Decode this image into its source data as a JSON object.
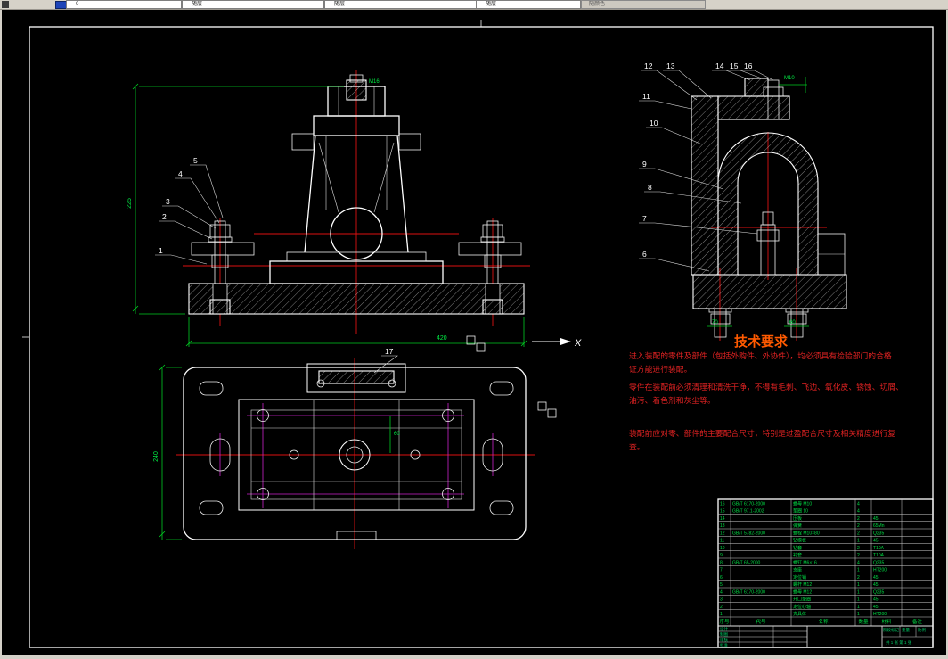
{
  "toolbar": {
    "layer_value": "0",
    "color_value": "随层",
    "linetype_value": "随层",
    "lineweight_value": "随层",
    "plotstyle_value": "随颜色"
  },
  "axis": {
    "x_label": "X"
  },
  "balloons": {
    "front": [
      "1",
      "2",
      "3",
      "4",
      "5"
    ],
    "side_top": [
      "12",
      "13",
      "14",
      "15",
      "16"
    ],
    "side_left": [
      "11",
      "10",
      "9",
      "8",
      "7",
      "6"
    ],
    "plan": [
      "17"
    ]
  },
  "dims": {
    "front_left": "225",
    "front_bottom": "420",
    "front_top_thread": "M16",
    "side_top_thread": "M10",
    "side_bolt_left": "70",
    "side_bolt_right": "60",
    "top_left": "240",
    "top_center": "60"
  },
  "tech": {
    "title": "技术要求",
    "lines": [
      "进入装配的零件及部件（包括外购件、外协件），均必须具有检验部门的合格",
      "证方能进行装配。",
      "零件在装配前必须清理和清洗干净，不得有毛刺、飞边、氧化皮、锈蚀、切屑、",
      "油污、着色剂和灰尘等。",
      "装配前应对零、部件的主要配合尺寸，特别是过盈配合尺寸及相关精度进行复",
      "查。"
    ]
  },
  "bom": {
    "headers": [
      "序号",
      "代号",
      "名称",
      "数量",
      "材料",
      "备注"
    ],
    "rows": [
      [
        "16",
        "GB/T 6170-2000",
        "螺母 M10",
        "4",
        "",
        ""
      ],
      [
        "15",
        "GB/T 97.1-2002",
        "垫圈 10",
        "4",
        "",
        ""
      ],
      [
        "14",
        "",
        "压板",
        "2",
        "45",
        ""
      ],
      [
        "13",
        "",
        "弹簧",
        "2",
        "65Mn",
        ""
      ],
      [
        "12",
        "GB/T 5782-2000",
        "螺栓 M10×80",
        "2",
        "Q235",
        ""
      ],
      [
        "11",
        "",
        "钻模板",
        "1",
        "45",
        ""
      ],
      [
        "10",
        "",
        "钻套",
        "2",
        "T10A",
        ""
      ],
      [
        "9",
        "",
        "衬套",
        "2",
        "T10A",
        ""
      ],
      [
        "8",
        "GB/T 65-2000",
        "螺钉 M6×16",
        "4",
        "Q235",
        ""
      ],
      [
        "7",
        "",
        "支座",
        "1",
        "HT200",
        ""
      ],
      [
        "6",
        "",
        "定位销",
        "2",
        "45",
        ""
      ],
      [
        "5",
        "",
        "螺杆 M12",
        "1",
        "45",
        ""
      ],
      [
        "4",
        "GB/T 6170-2000",
        "螺母 M12",
        "1",
        "Q235",
        ""
      ],
      [
        "3",
        "",
        "开口垫圈",
        "1",
        "45",
        ""
      ],
      [
        "2",
        "",
        "定位心轴",
        "1",
        "45",
        ""
      ],
      [
        "1",
        "",
        "夹具体",
        "1",
        "HT200",
        ""
      ]
    ]
  },
  "title_block": {
    "labels": [
      "设计",
      "制图",
      "审核",
      "批准"
    ],
    "stage_label": "阶段标记",
    "weight_label": "重量",
    "scale_label": "比例",
    "sheet_info": "共 1 张 第 1 张"
  }
}
